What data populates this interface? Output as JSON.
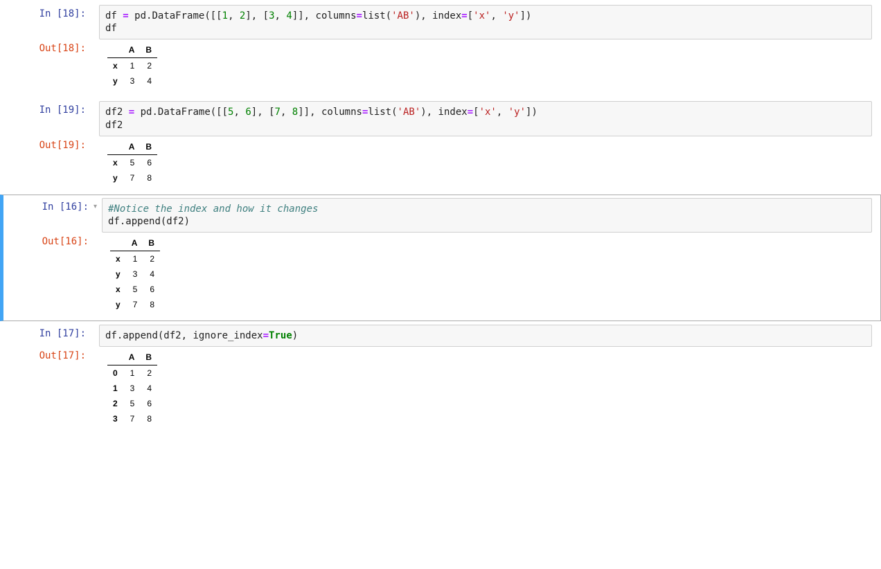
{
  "cells": [
    {
      "execution_count": 18,
      "in_label": "In [18]:",
      "out_label": "Out[18]:",
      "code_tokens": [
        {
          "t": "df ",
          "c": "tok-var"
        },
        {
          "t": "=",
          "c": "tok-op"
        },
        {
          "t": " pd",
          "c": "tok-var"
        },
        {
          "t": ".",
          "c": "tok-punc"
        },
        {
          "t": "DataFrame([[",
          "c": "tok-call"
        },
        {
          "t": "1",
          "c": "tok-num"
        },
        {
          "t": ", ",
          "c": "tok-punc"
        },
        {
          "t": "2",
          "c": "tok-num"
        },
        {
          "t": "], [",
          "c": "tok-punc"
        },
        {
          "t": "3",
          "c": "tok-num"
        },
        {
          "t": ", ",
          "c": "tok-punc"
        },
        {
          "t": "4",
          "c": "tok-num"
        },
        {
          "t": "]], columns",
          "c": "tok-punc"
        },
        {
          "t": "=",
          "c": "tok-op"
        },
        {
          "t": "list",
          "c": "tok-call"
        },
        {
          "t": "(",
          "c": "tok-punc"
        },
        {
          "t": "'AB'",
          "c": "tok-str"
        },
        {
          "t": "), index",
          "c": "tok-punc"
        },
        {
          "t": "=",
          "c": "tok-op"
        },
        {
          "t": "[",
          "c": "tok-punc"
        },
        {
          "t": "'x'",
          "c": "tok-str"
        },
        {
          "t": ", ",
          "c": "tok-punc"
        },
        {
          "t": "'y'",
          "c": "tok-str"
        },
        {
          "t": "])",
          "c": "tok-punc"
        },
        {
          "t": "\n",
          "c": ""
        },
        {
          "t": "df",
          "c": "tok-var"
        }
      ],
      "output_table": {
        "columns": [
          "A",
          "B"
        ],
        "index": [
          "x",
          "y"
        ],
        "data": [
          [
            1,
            2
          ],
          [
            3,
            4
          ]
        ]
      }
    },
    {
      "execution_count": 19,
      "in_label": "In [19]:",
      "out_label": "Out[19]:",
      "code_tokens": [
        {
          "t": "df2 ",
          "c": "tok-var"
        },
        {
          "t": "=",
          "c": "tok-op"
        },
        {
          "t": " pd",
          "c": "tok-var"
        },
        {
          "t": ".",
          "c": "tok-punc"
        },
        {
          "t": "DataFrame([[",
          "c": "tok-call"
        },
        {
          "t": "5",
          "c": "tok-num"
        },
        {
          "t": ", ",
          "c": "tok-punc"
        },
        {
          "t": "6",
          "c": "tok-num"
        },
        {
          "t": "], [",
          "c": "tok-punc"
        },
        {
          "t": "7",
          "c": "tok-num"
        },
        {
          "t": ", ",
          "c": "tok-punc"
        },
        {
          "t": "8",
          "c": "tok-num"
        },
        {
          "t": "]], columns",
          "c": "tok-punc"
        },
        {
          "t": "=",
          "c": "tok-op"
        },
        {
          "t": "list",
          "c": "tok-call"
        },
        {
          "t": "(",
          "c": "tok-punc"
        },
        {
          "t": "'AB'",
          "c": "tok-str"
        },
        {
          "t": "), index",
          "c": "tok-punc"
        },
        {
          "t": "=",
          "c": "tok-op"
        },
        {
          "t": "[",
          "c": "tok-punc"
        },
        {
          "t": "'x'",
          "c": "tok-str"
        },
        {
          "t": ", ",
          "c": "tok-punc"
        },
        {
          "t": "'y'",
          "c": "tok-str"
        },
        {
          "t": "])",
          "c": "tok-punc"
        },
        {
          "t": "\n",
          "c": ""
        },
        {
          "t": "df2",
          "c": "tok-var"
        }
      ],
      "output_table": {
        "columns": [
          "A",
          "B"
        ],
        "index": [
          "x",
          "y"
        ],
        "data": [
          [
            5,
            6
          ],
          [
            7,
            8
          ]
        ]
      }
    },
    {
      "execution_count": 16,
      "in_label": "In [16]:",
      "out_label": "Out[16]:",
      "selected": true,
      "code_tokens": [
        {
          "t": "#Notice the index and how it changes",
          "c": "tok-comment"
        },
        {
          "t": "\n",
          "c": ""
        },
        {
          "t": "df",
          "c": "tok-var"
        },
        {
          "t": ".",
          "c": "tok-punc"
        },
        {
          "t": "append(df2)",
          "c": "tok-call"
        }
      ],
      "output_table": {
        "columns": [
          "A",
          "B"
        ],
        "index": [
          "x",
          "y",
          "x",
          "y"
        ],
        "data": [
          [
            1,
            2
          ],
          [
            3,
            4
          ],
          [
            5,
            6
          ],
          [
            7,
            8
          ]
        ]
      }
    },
    {
      "execution_count": 17,
      "in_label": "In [17]:",
      "out_label": "Out[17]:",
      "code_tokens": [
        {
          "t": "df",
          "c": "tok-var"
        },
        {
          "t": ".",
          "c": "tok-punc"
        },
        {
          "t": "append(df2, ignore_index",
          "c": "tok-call"
        },
        {
          "t": "=",
          "c": "tok-op"
        },
        {
          "t": "True",
          "c": "tok-kw"
        },
        {
          "t": ")",
          "c": "tok-punc"
        }
      ],
      "output_table": {
        "columns": [
          "A",
          "B"
        ],
        "index": [
          "0",
          "1",
          "2",
          "3"
        ],
        "data": [
          [
            1,
            2
          ],
          [
            3,
            4
          ],
          [
            5,
            6
          ],
          [
            7,
            8
          ]
        ]
      }
    }
  ],
  "collapse_arrow": "▾"
}
